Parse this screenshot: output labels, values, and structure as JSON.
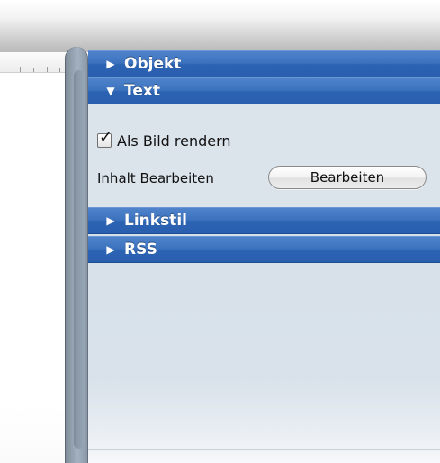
{
  "inspector": {
    "sections": {
      "objekt": {
        "label": "Objekt",
        "expanded": false,
        "indicator": "disclosure-right-icon"
      },
      "text": {
        "label": "Text",
        "expanded": true,
        "indicator": "disclosure-down-icon",
        "render_as_image": {
          "label": "Als Bild rendern",
          "checked": true
        },
        "edit_content": {
          "label": "Inhalt Bearbeiten",
          "button_label": "Bearbeiten"
        }
      },
      "linkstil": {
        "label": "Linkstil",
        "expanded": false,
        "indicator": "disclosure-right-icon"
      },
      "rss": {
        "label": "RSS",
        "expanded": false,
        "indicator": "disclosure-right-icon"
      }
    }
  },
  "colors": {
    "section_header": "#3c71bd",
    "panel_background": "#d6dfe8"
  }
}
